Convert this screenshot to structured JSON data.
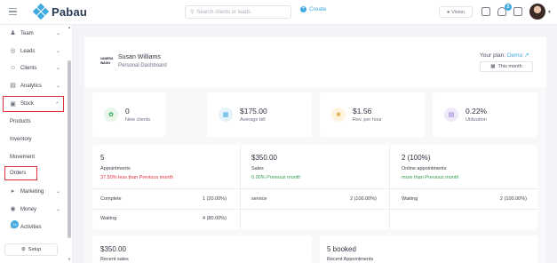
{
  "header": {
    "app_name": "Pabau",
    "search_placeholder": "Search clients or leads",
    "create_label": "Create",
    "vision_label": "Vision",
    "notification_count": "2"
  },
  "sidebar": {
    "items": [
      {
        "label": "Team",
        "icon": "team-icon"
      },
      {
        "label": "Leads",
        "icon": "leads-icon"
      },
      {
        "label": "Clients",
        "icon": "clients-icon"
      },
      {
        "label": "Analytics",
        "icon": "analytics-icon"
      },
      {
        "label": "Stock",
        "icon": "stock-icon"
      },
      {
        "label": "Marketing",
        "icon": "marketing-icon"
      },
      {
        "label": "Money",
        "icon": "money-icon"
      },
      {
        "label": "Activities",
        "icon": "activities-icon"
      }
    ],
    "stock_sub": [
      "Products",
      "Inventory",
      "Movement",
      "Orders"
    ],
    "activities_badge": "16",
    "setup_label": "Setup"
  },
  "dashboard": {
    "logo_text": "#ANERA WAGN",
    "user_name": "Susan Williams",
    "user_sub": "Personal Dashboard",
    "plan_label": "Your plan:",
    "plan_value": "Demo",
    "period_label": "This month"
  },
  "kpis": [
    {
      "value": "0",
      "label": "New clients",
      "icon": "new-clients-icon",
      "color": "#e8f6ec"
    },
    {
      "value": "$175.00",
      "label": "Average bill",
      "icon": "bill-icon",
      "color": "#e6f3fb"
    },
    {
      "value": "$1.56",
      "label": "Rev. per hour",
      "icon": "revenue-icon",
      "color": "#fdf3df"
    },
    {
      "value": "0.22%",
      "label": "Utilization",
      "icon": "utilization-icon",
      "color": "#efeafa"
    }
  ],
  "cards": {
    "appointments": {
      "value": "5",
      "label": "Appointments",
      "trend": "37.50% less than Previous month",
      "rows": [
        {
          "name": "Complete",
          "value": "1 (20.00%)"
        },
        {
          "name": "Waiting",
          "value": "4 (80.00%)"
        }
      ]
    },
    "sales": {
      "value": "$350.00",
      "label": "Sales",
      "trend": "0.00% Previous month",
      "rows": [
        {
          "name": "service",
          "value": "2 (100.00%)"
        }
      ]
    },
    "online": {
      "value": "2 (100%)",
      "label": "Online appointments",
      "trend": "more than Previous month",
      "rows": [
        {
          "name": "Waiting",
          "value": "2 (100.00%)"
        }
      ]
    },
    "recent_sales": {
      "value": "$350.00",
      "label": "Recent sales"
    },
    "recent_appointments": {
      "value": "5 booked",
      "label": "Recent Appointments"
    }
  },
  "colors": {
    "accent": "#3fa9e0",
    "highlight": "#e0303a",
    "positive": "#2e9e4a"
  }
}
